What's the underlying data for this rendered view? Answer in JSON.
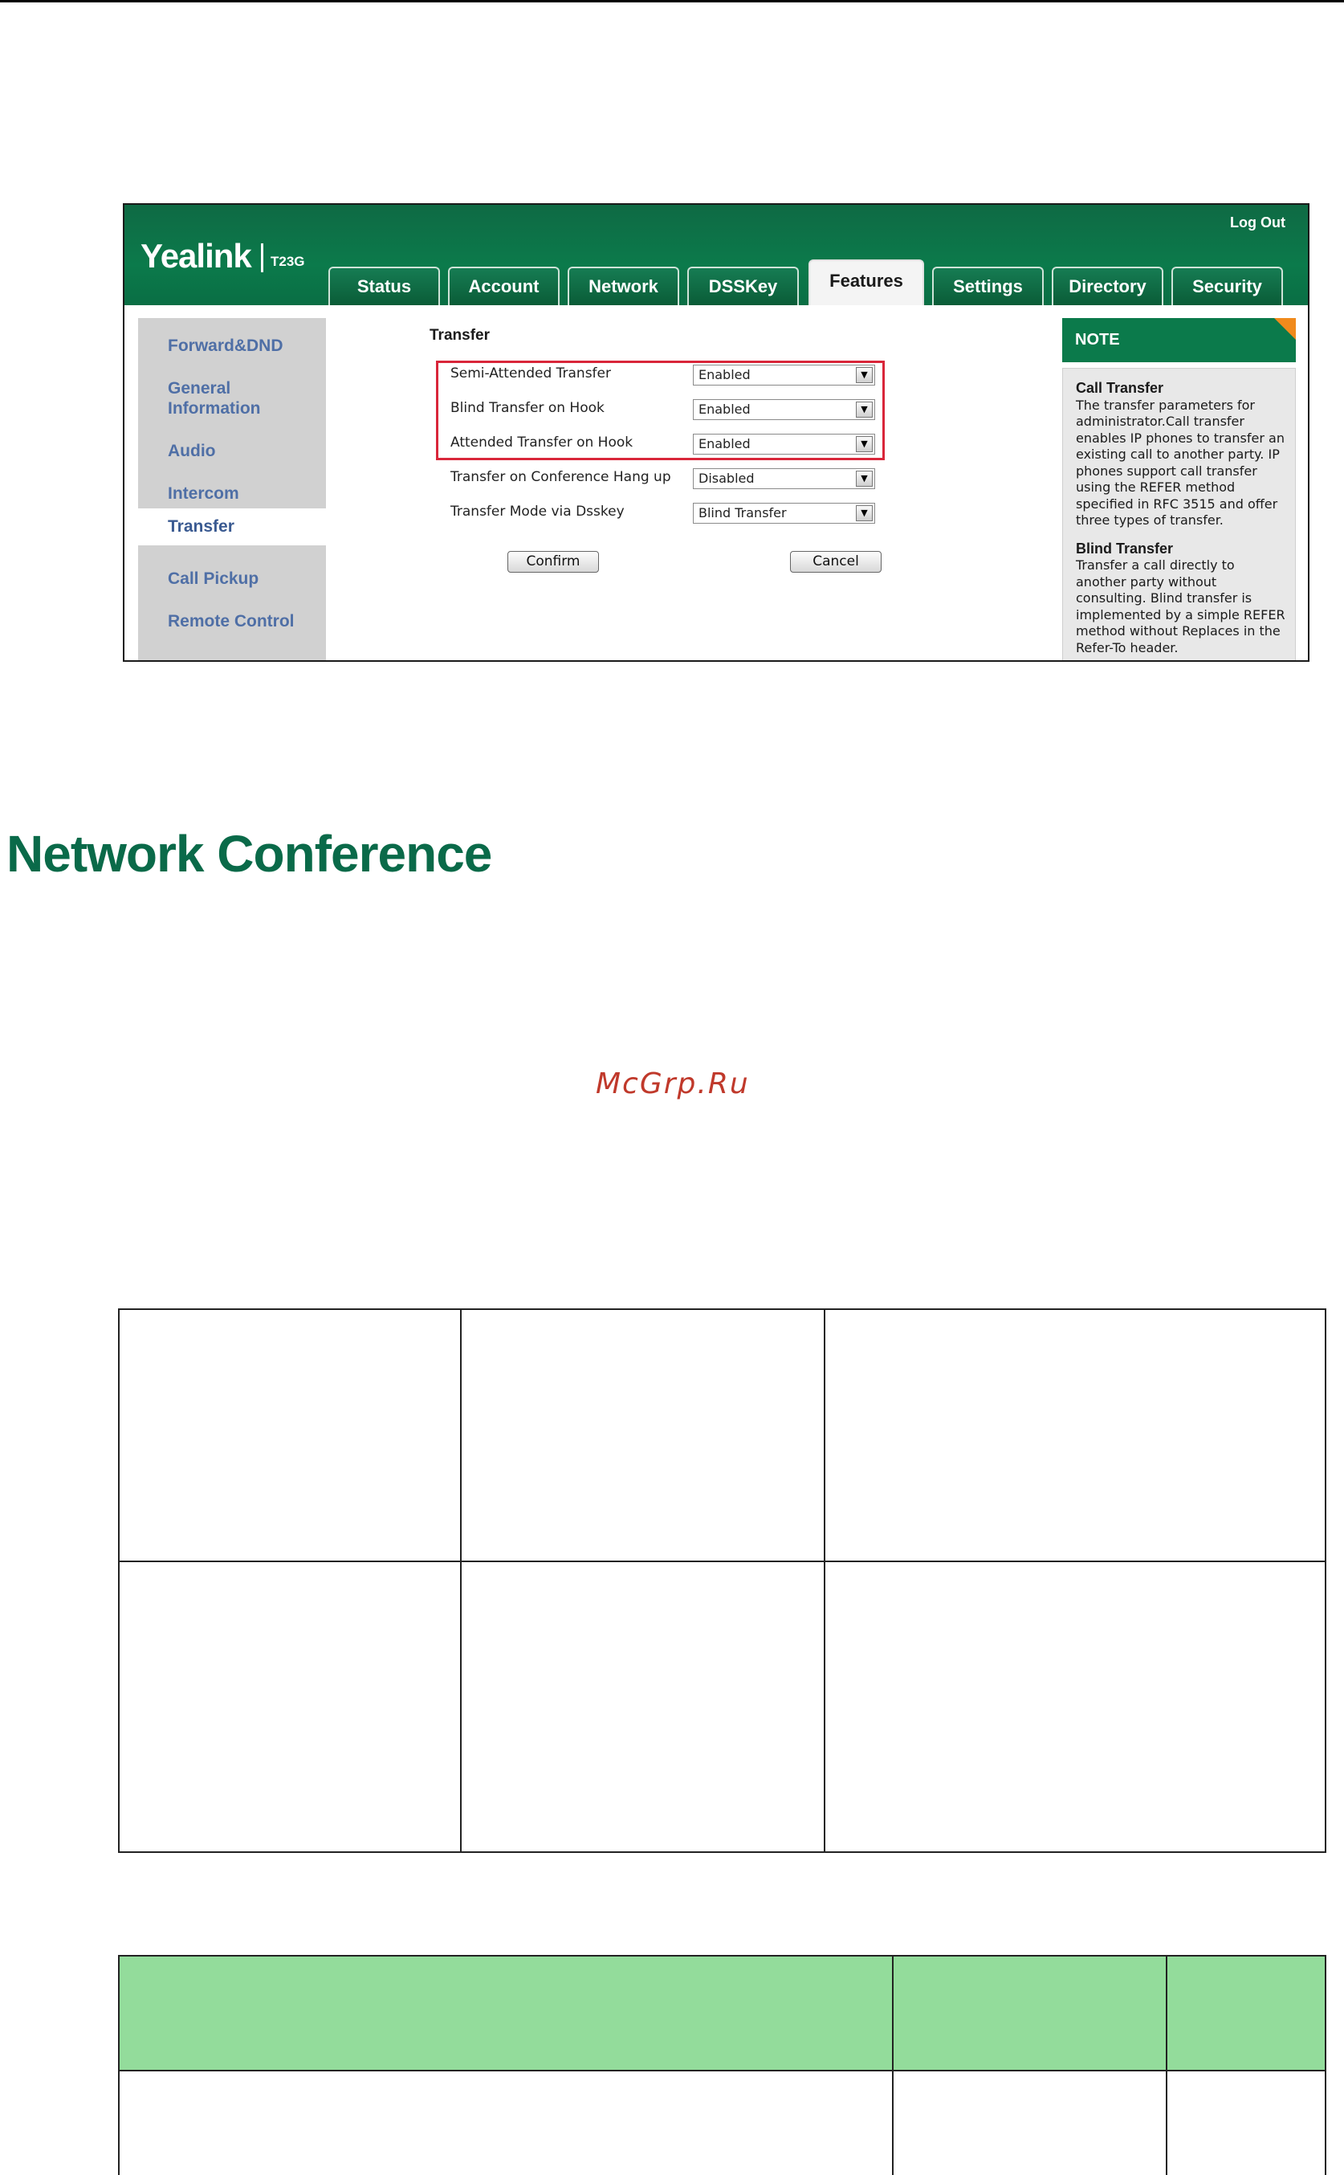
{
  "screenshot": {
    "brand": "Yealink",
    "model": "T23G",
    "logout_label": "Log Out",
    "tabs": [
      "Status",
      "Account",
      "Network",
      "DSSKey",
      "Features",
      "Settings",
      "Directory",
      "Security"
    ],
    "active_tab": "Features",
    "sidebar": [
      "Forward&DND",
      "General Information",
      "Audio",
      "Intercom",
      "Transfer",
      "Call Pickup",
      "Remote Control"
    ],
    "active_sidebar": "Transfer",
    "form": {
      "title": "Transfer",
      "fields": [
        {
          "label": "Semi-Attended Transfer",
          "value": "Enabled"
        },
        {
          "label": "Blind Transfer on Hook",
          "value": "Enabled"
        },
        {
          "label": "Attended Transfer on Hook",
          "value": "Enabled"
        },
        {
          "label": "Transfer on Conference Hang up",
          "value": "Disabled"
        },
        {
          "label": "Transfer Mode via Dsskey",
          "value": "Blind Transfer"
        }
      ],
      "confirm_label": "Confirm",
      "cancel_label": "Cancel"
    },
    "note": {
      "title": "NOTE",
      "sections": [
        {
          "heading": "Call Transfer",
          "text": "The transfer parameters for administrator.Call transfer enables IP phones to transfer an existing call to another party. IP phones support call transfer using the REFER method specified in RFC 3515 and offer three types of transfer."
        },
        {
          "heading": "Blind Transfer",
          "text": "Transfer a call directly to another party without consulting. Blind transfer is implemented by a simple REFER method without Replaces in the Refer-To header."
        }
      ]
    }
  },
  "document": {
    "heading": "Network Conference",
    "watermark": "McGrp.Ru"
  },
  "colors": {
    "brand_green": "#0b7a4b",
    "heading_green": "#0a6a49",
    "table_header_green": "#93dc9b",
    "highlight_red": "#d9263a",
    "note_corner_orange": "#f08a1c"
  }
}
